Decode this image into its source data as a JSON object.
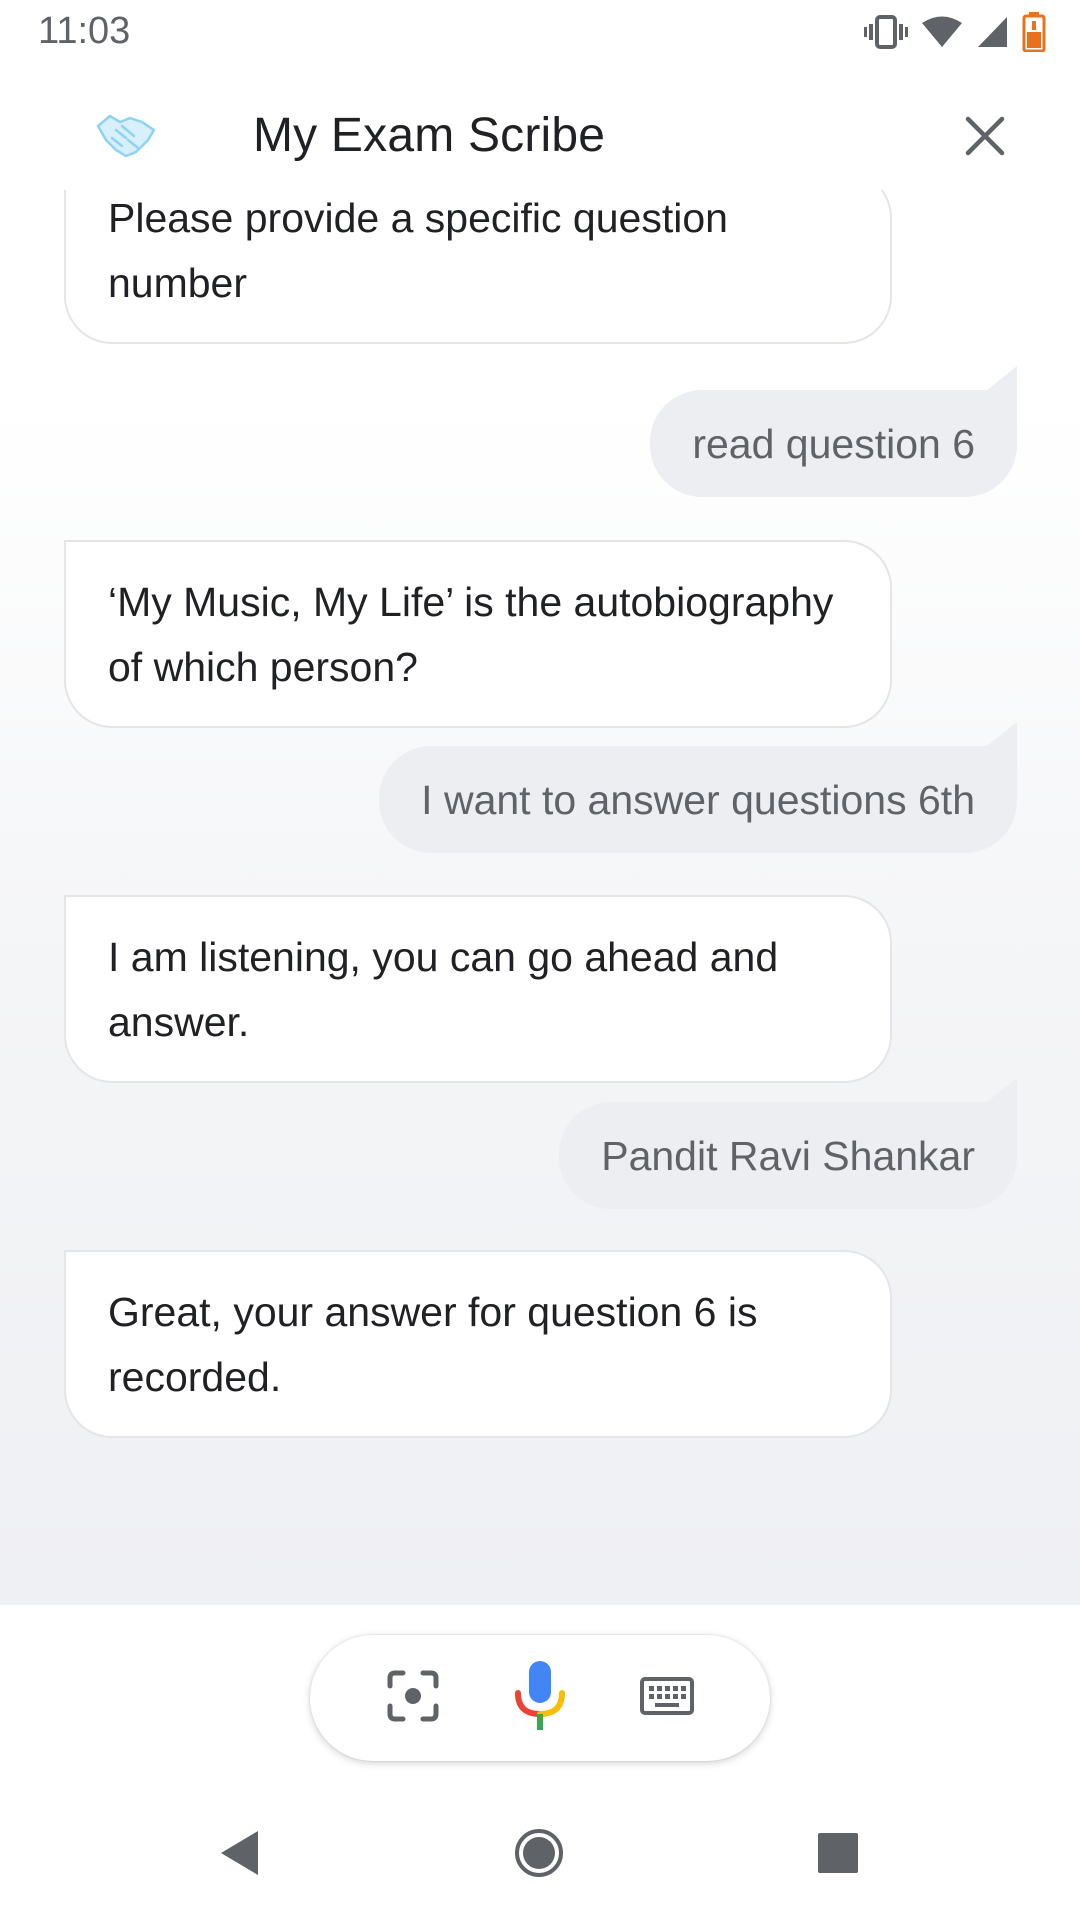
{
  "status_bar": {
    "time": "11:03",
    "icons": [
      "vibrate-icon",
      "wifi-icon",
      "cell-signal-icon",
      "battery-low-icon"
    ],
    "battery_color": "#e8711c"
  },
  "header": {
    "title": "My Exam Scribe",
    "logo_icon": "handshake-logo-icon",
    "close_icon": "close-icon"
  },
  "conversation": {
    "messages": [
      {
        "role": "assistant",
        "text": "Please provide a specific question number"
      },
      {
        "role": "user",
        "text": "read question 6"
      },
      {
        "role": "assistant",
        "text": "‘My Music, My Life’ is the autobiography of which person?"
      },
      {
        "role": "user",
        "text": "I want to answer questions 6th"
      },
      {
        "role": "assistant",
        "text": "I am listening, you can go ahead and answer."
      },
      {
        "role": "user",
        "text": "Pandit Ravi Shankar"
      },
      {
        "role": "assistant",
        "text": "Great, your answer for question 6 is recorded."
      }
    ]
  },
  "input_bar": {
    "buttons": [
      "lens-icon",
      "microphone-icon",
      "keyboard-icon"
    ]
  },
  "nav_bar": {
    "buttons": [
      "back-icon",
      "home-icon",
      "recents-icon"
    ]
  },
  "colors": {
    "google_blue": "#4285f4",
    "google_red": "#ea4335",
    "google_yellow": "#fbbc04",
    "google_green": "#34a853",
    "logo_blue": "#8fd3f4",
    "user_bubble": "#eceef1"
  }
}
